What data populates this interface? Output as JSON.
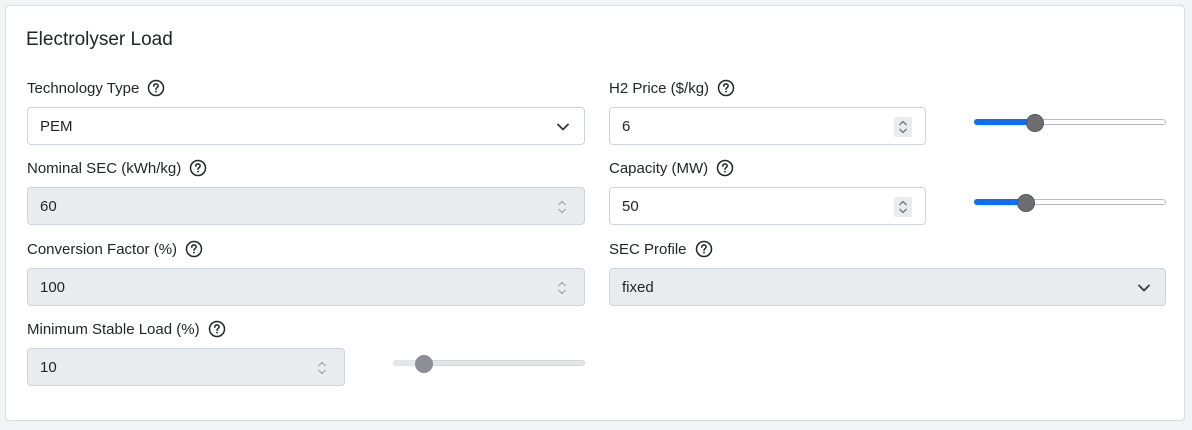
{
  "panel": {
    "title": "Electrolyser Load"
  },
  "fields": {
    "technology_type": {
      "label": "Technology Type",
      "value": "PEM",
      "icon": "help-circle-icon"
    },
    "nominal_sec": {
      "label": "Nominal SEC (kWh/kg)",
      "value": "60",
      "disabled": true
    },
    "conversion_factor": {
      "label": "Conversion Factor (%)",
      "value": "100",
      "disabled": true
    },
    "minimum_stable_load": {
      "label": "Minimum Stable Load (%)",
      "value": "10",
      "disabled": true,
      "slider_fraction": 0.16
    },
    "h2_price": {
      "label": "H2 Price ($/kg)",
      "value": "6",
      "slider_fraction": 0.32
    },
    "capacity": {
      "label": "Capacity (MW)",
      "value": "50",
      "slider_fraction": 0.27
    },
    "sec_profile": {
      "label": "SEC Profile",
      "value": "fixed",
      "disabled": true
    }
  },
  "colors": {
    "accent": "#0d6efd",
    "disabled_bg": "#e9ecef",
    "border": "#ced4da",
    "thumb": "#6c6e72"
  }
}
